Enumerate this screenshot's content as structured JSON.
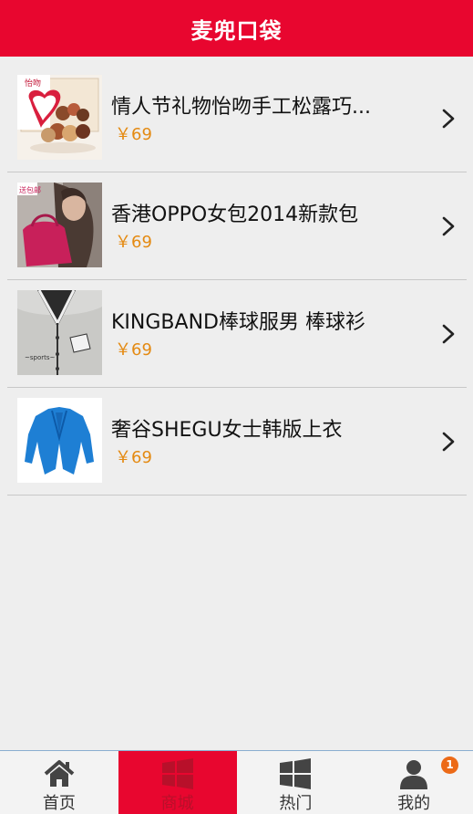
{
  "header": {
    "title": "麦兜口袋"
  },
  "products": [
    {
      "title": "情人节礼物怡吻手工松露巧...",
      "price": "￥69",
      "image": "chocolate-gift-box"
    },
    {
      "title": "香港OPPO女包2014新款包",
      "price": "￥69",
      "image": "pink-handbag-model"
    },
    {
      "title": "KINGBAND棒球服男 棒球衫",
      "price": "￥69",
      "image": "baseball-jacket"
    },
    {
      "title": "奢谷SHEGU女士韩版上衣",
      "price": "￥69",
      "image": "blue-cardigan"
    }
  ],
  "tabs": [
    {
      "label": "首页",
      "icon": "home-icon"
    },
    {
      "label": "商城",
      "icon": "windows-icon",
      "active": true
    },
    {
      "label": "热门",
      "icon": "windows-icon"
    },
    {
      "label": "我的",
      "icon": "user-icon",
      "badge": "1"
    }
  ],
  "colors": {
    "brand": "#e8062f",
    "price": "#e48a12",
    "badge": "#ec6a17"
  }
}
